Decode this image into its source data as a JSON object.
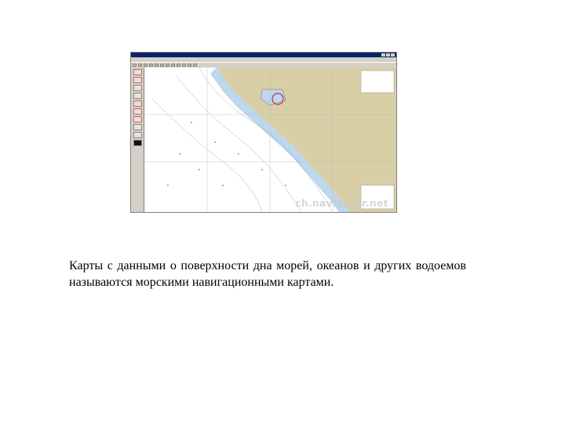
{
  "window": {
    "title": "",
    "menu": [
      "",
      "",
      "",
      "",
      "",
      "",
      "",
      ""
    ]
  },
  "chart_labels": {
    "watermark": "ch.navigator.net"
  },
  "caption": "Карты с данными о поверхности дна морей, океанов и других водоемов называются морскими навигационными картами.",
  "colors": {
    "land": "#d8cfa6",
    "shallow_water": "#bcd7ee",
    "deep_water": "#ffffff",
    "window_chrome": "#d4d0c8",
    "titlebar": "#0a246a"
  }
}
